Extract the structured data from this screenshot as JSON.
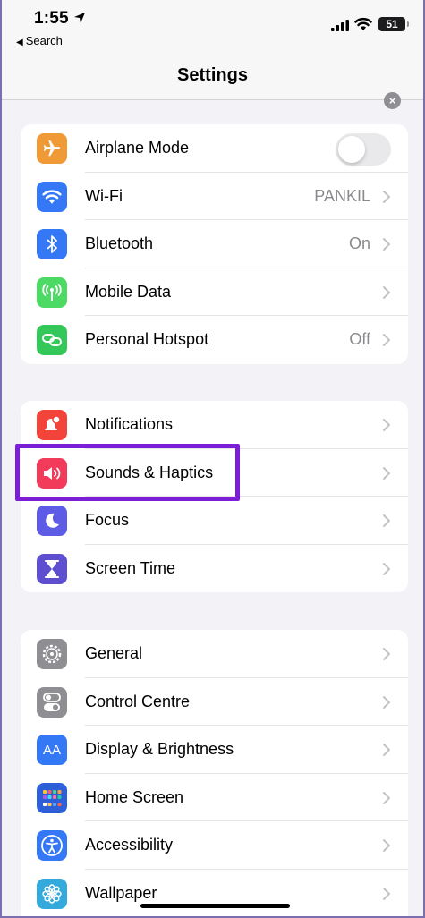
{
  "status_bar": {
    "time": "1:55",
    "back_label": "Search",
    "battery": "51"
  },
  "nav": {
    "title": "Settings",
    "dismiss_symbol": "×"
  },
  "colors": {
    "airplane": "#f09a37",
    "wifi": "#3478f6",
    "bluetooth": "#3478f6",
    "mobile_data": "#4cd964",
    "hotspot": "#34c759",
    "notifications": "#f2443a",
    "sounds": "#f23a5b",
    "focus": "#5e5ce6",
    "screen_time": "#5e4fd1",
    "general": "#8e8e93",
    "control_centre": "#8e8e93",
    "display": "#3478f6",
    "home_screen": "#3478f6",
    "accessibility": "#3478f6",
    "wallpaper": "#34aadc",
    "highlight": "#7b1fd6"
  },
  "groups": [
    {
      "items": [
        {
          "label": "Airplane Mode",
          "icon": "airplane-icon",
          "toggle": "off"
        },
        {
          "label": "Wi-Fi",
          "icon": "wifi-icon",
          "value": "PANKIL"
        },
        {
          "label": "Bluetooth",
          "icon": "bluetooth-icon",
          "value": "On"
        },
        {
          "label": "Mobile Data",
          "icon": "antenna-icon",
          "value": ""
        },
        {
          "label": "Personal Hotspot",
          "icon": "hotspot-icon",
          "value": "Off"
        }
      ]
    },
    {
      "items": [
        {
          "label": "Notifications",
          "icon": "notifications-icon"
        },
        {
          "label": "Sounds & Haptics",
          "icon": "speaker-icon"
        },
        {
          "label": "Focus",
          "icon": "moon-icon"
        },
        {
          "label": "Screen Time",
          "icon": "hourglass-icon"
        }
      ]
    },
    {
      "items": [
        {
          "label": "General",
          "icon": "gear-icon"
        },
        {
          "label": "Control Centre",
          "icon": "toggles-icon"
        },
        {
          "label": "Display & Brightness",
          "icon": "text-size-icon",
          "icon_text": "AA"
        },
        {
          "label": "Home Screen",
          "icon": "app-grid-icon"
        },
        {
          "label": "Accessibility",
          "icon": "accessibility-icon"
        },
        {
          "label": "Wallpaper",
          "icon": "flower-icon"
        }
      ]
    }
  ]
}
